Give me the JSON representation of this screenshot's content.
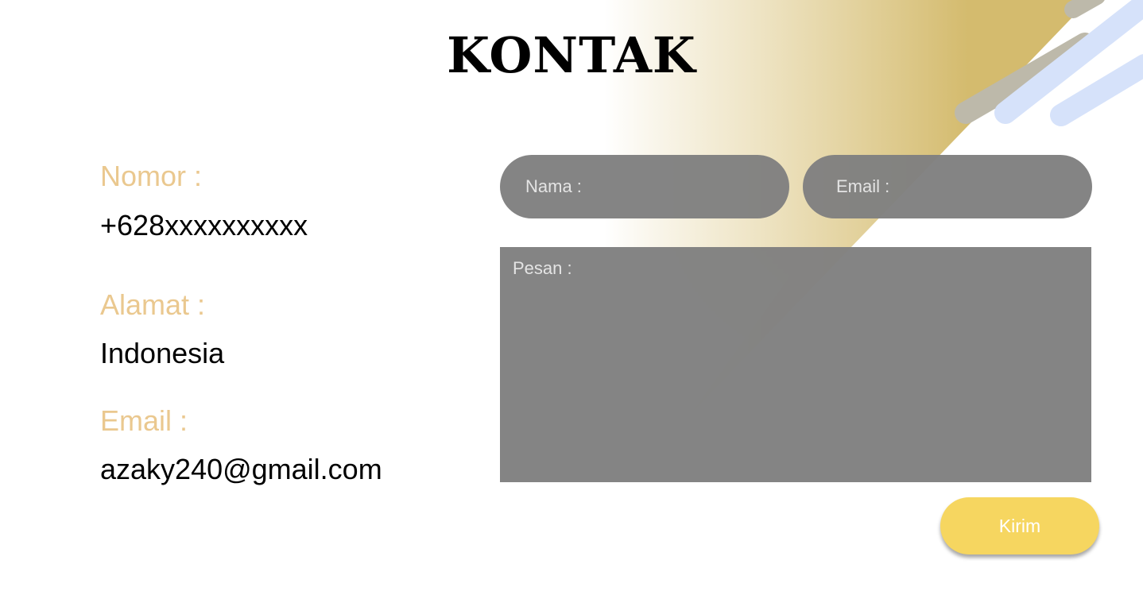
{
  "page": {
    "title": "KONTAK"
  },
  "info": {
    "phone_label": "Nomor :",
    "phone_value": "+628xxxxxxxxxx",
    "address_label": "Alamat :",
    "address_value": "Indonesia",
    "email_label": "Email :",
    "email_value": "azaky240@gmail.com"
  },
  "form": {
    "name_placeholder": "Nama :",
    "email_placeholder": "Email :",
    "message_placeholder": "Pesan :",
    "submit_label": "Kirim"
  },
  "colors": {
    "label": "#eac88f",
    "field_bg": "#808080",
    "button": "#f6d660",
    "gold_accent": "#d4bb6e",
    "blue_stripe": "#d6e2fa"
  }
}
